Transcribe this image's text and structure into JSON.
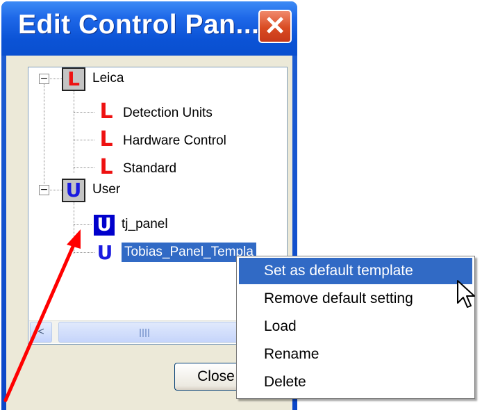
{
  "window": {
    "title": "Edit Control Pan...",
    "close_glyph": "✕",
    "title_color": "#0a4fcf"
  },
  "tree": {
    "nodes": [
      {
        "label": "Leica",
        "icon": "leica-group-icon",
        "expander": "−"
      },
      {
        "label": "Detection Units",
        "icon": "leica-icon"
      },
      {
        "label": "Hardware Control",
        "icon": "leica-icon"
      },
      {
        "label": "Standard",
        "icon": "leica-icon"
      },
      {
        "label": "User",
        "icon": "user-group-icon",
        "expander": "−"
      },
      {
        "label": "tj_panel",
        "icon": "user-default-icon"
      },
      {
        "label": "Tobias_Panel_Templa",
        "icon": "user-icon",
        "selected": true
      }
    ],
    "icon_letters": {
      "leica": "L",
      "user": "U"
    }
  },
  "scrollbar": {
    "left_arrow": "<",
    "grip": "|||"
  },
  "buttons": {
    "close_label": "Close"
  },
  "context_menu": {
    "items": [
      {
        "label": "Set as default template",
        "highlighted": true
      },
      {
        "label": "Remove default setting"
      },
      {
        "label": "Load"
      },
      {
        "label": "Rename"
      },
      {
        "label": "Delete"
      }
    ]
  },
  "colors": {
    "selection": "#316ac5",
    "leica_red": "#ee1111",
    "user_blue": "#1a1ae0",
    "annotation_arrow": "#ff0000"
  }
}
